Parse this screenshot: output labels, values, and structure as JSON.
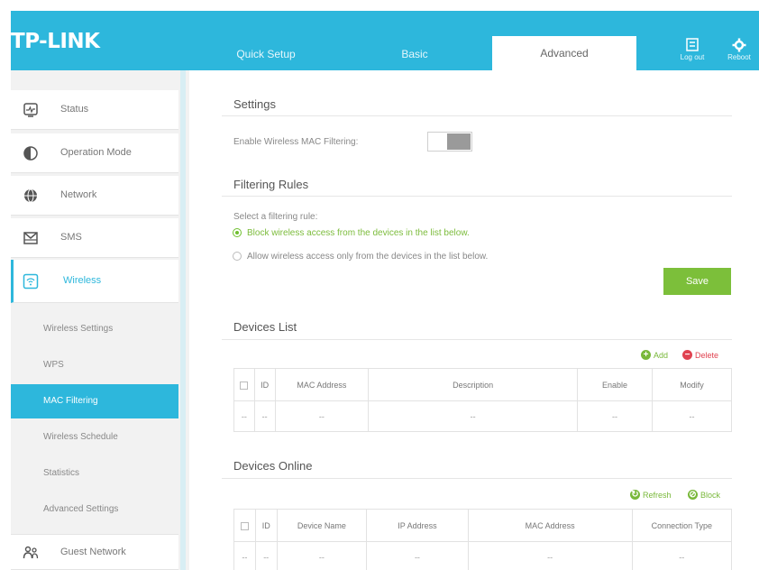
{
  "header": {
    "logo": "TP-LINK",
    "tabs": [
      {
        "label": "Quick Setup"
      },
      {
        "label": "Basic"
      },
      {
        "label": "Advanced"
      }
    ],
    "logout_label": "Log out",
    "reboot_label": "Reboot"
  },
  "sidebar": {
    "items": [
      {
        "label": "Status",
        "icon": "status-icon"
      },
      {
        "label": "Operation Mode",
        "icon": "operation-mode-icon"
      },
      {
        "label": "Network",
        "icon": "globe-icon"
      },
      {
        "label": "SMS",
        "icon": "sms-icon"
      },
      {
        "label": "Wireless",
        "icon": "wireless-icon"
      },
      {
        "label": "Guest Network",
        "icon": "guest-network-icon"
      }
    ],
    "sub_items": [
      {
        "label": "Wireless Settings"
      },
      {
        "label": "WPS"
      },
      {
        "label": "MAC Filtering"
      },
      {
        "label": "Wireless Schedule"
      },
      {
        "label": "Statistics"
      },
      {
        "label": "Advanced Settings"
      }
    ]
  },
  "settings": {
    "title": "Settings",
    "enable_label": "Enable Wireless MAC Filtering:",
    "enabled": false
  },
  "filtering": {
    "title": "Filtering Rules",
    "prompt": "Select a filtering rule:",
    "rules": [
      {
        "label": "Block wireless access from the devices in the list below.",
        "selected": true
      },
      {
        "label": "Allow wireless access only from the devices in the list below.",
        "selected": false
      }
    ],
    "save_label": "Save"
  },
  "devices_list": {
    "title": "Devices List",
    "add_label": "Add",
    "delete_label": "Delete",
    "columns": [
      "ID",
      "MAC Address",
      "Description",
      "Enable",
      "Modify"
    ],
    "rows": [
      [
        "--",
        "--",
        "--",
        "--",
        "--",
        "--"
      ]
    ]
  },
  "devices_online": {
    "title": "Devices Online",
    "refresh_label": "Refresh",
    "block_label": "Block",
    "columns": [
      "ID",
      "Device Name",
      "IP Address",
      "MAC Address",
      "Connection Type"
    ],
    "rows": [
      [
        "--",
        "--",
        "--",
        "--",
        "--",
        "--"
      ]
    ]
  },
  "colors": {
    "brand": "#2db7dc",
    "save": "#7cbf3a",
    "delete": "#e04250"
  }
}
